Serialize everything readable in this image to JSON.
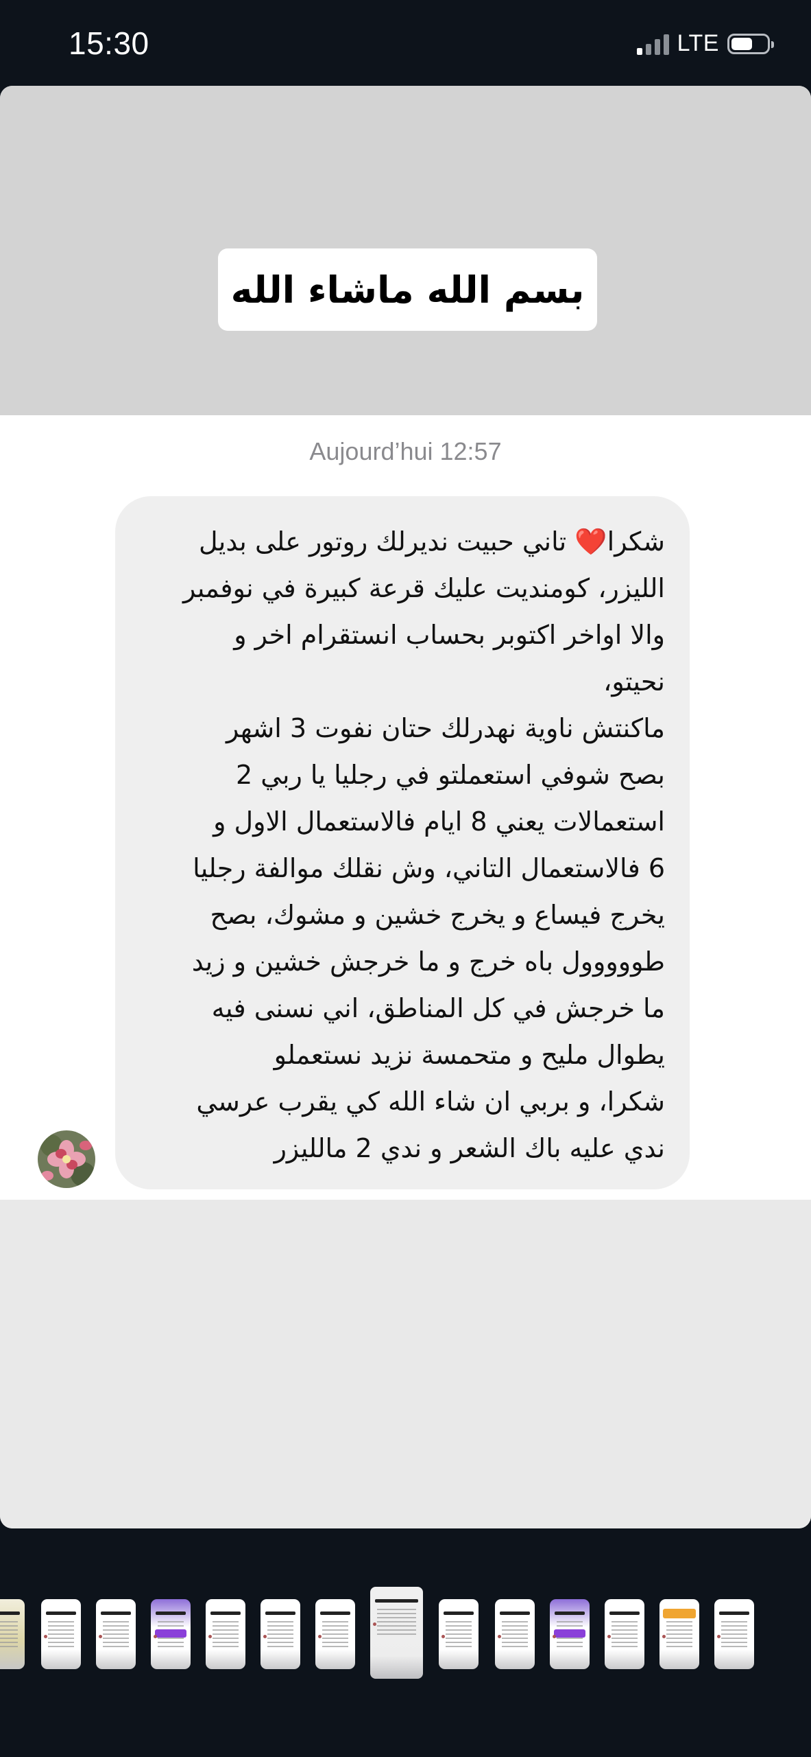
{
  "status_bar": {
    "time": "15:30",
    "network": "LTE",
    "signal_bars_filled": 1,
    "signal_bars_total": 4,
    "battery_level": 0.5
  },
  "story": {
    "caption": "بسم الله ماشاء الله",
    "timestamp": "Aujourd’hui 12:57",
    "message": "شكرا❤️ تاني حبيت نديرلك روتور على بديل\nالليزر، كومنديت عليك قرعة كبيرة في نوفمبر\nوالا اواخر اكتوبر بحساب انستقرام اخر و\nنحيتو،\nماكنتش ناوية نهدرلك حتان نفوت 3 اشهر\nبصح شوفي استعملتو في رجليا يا ربي 2\nاستعمالات يعني 8 ايام فالاستعمال الاول و\n6 فالاستعمال التاني، وش نقلك موالفة رجليا\nيخرج فيساع و يخرج خشين و مشوك، بصح\nطووووول باه خرج و ما خرجش خشين و زيد\nما خرجش في كل المناطق، اني نسنى فيه\nيطوال مليح و متحمسة نزيد نستعملو\nشكرا، و بربي ان شاء الله كي يقرب عرسي\nندي عليه باك الشعر و ندي 2 مالليزر",
    "avatar_icon": "flower-avatar"
  },
  "thumbnails": {
    "count": 14,
    "current_index": 7
  },
  "colors": {
    "background": "#0d131b",
    "story_top": "#d3d3d3",
    "bubble": "#efefef",
    "timestamp": "#8a8a8e"
  }
}
